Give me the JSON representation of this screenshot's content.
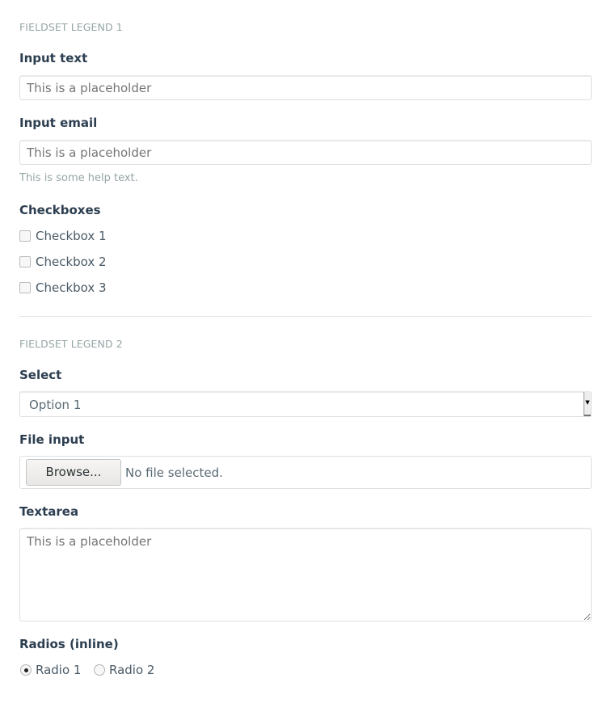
{
  "fieldset1": {
    "legend": "FIELDSET LEGEND 1",
    "input_text": {
      "label": "Input text",
      "placeholder": "This is a placeholder"
    },
    "input_email": {
      "label": "Input email",
      "placeholder": "This is a placeholder",
      "help": "This is some help text."
    },
    "checkboxes": {
      "label": "Checkboxes",
      "items": [
        {
          "label": "Checkbox 1",
          "checked": false
        },
        {
          "label": "Checkbox 2",
          "checked": false
        },
        {
          "label": "Checkbox 3",
          "checked": false
        }
      ]
    }
  },
  "fieldset2": {
    "legend": "FIELDSET LEGEND 2",
    "select": {
      "label": "Select",
      "value": "Option 1"
    },
    "file": {
      "label": "File input",
      "button": "Browse...",
      "status": "No file selected."
    },
    "textarea": {
      "label": "Textarea",
      "placeholder": "This is a placeholder"
    },
    "radios": {
      "label": "Radios (inline)",
      "items": [
        {
          "label": "Radio 1",
          "checked": true
        },
        {
          "label": "Radio 2",
          "checked": false
        }
      ],
      "selected": "Radio 1"
    }
  }
}
